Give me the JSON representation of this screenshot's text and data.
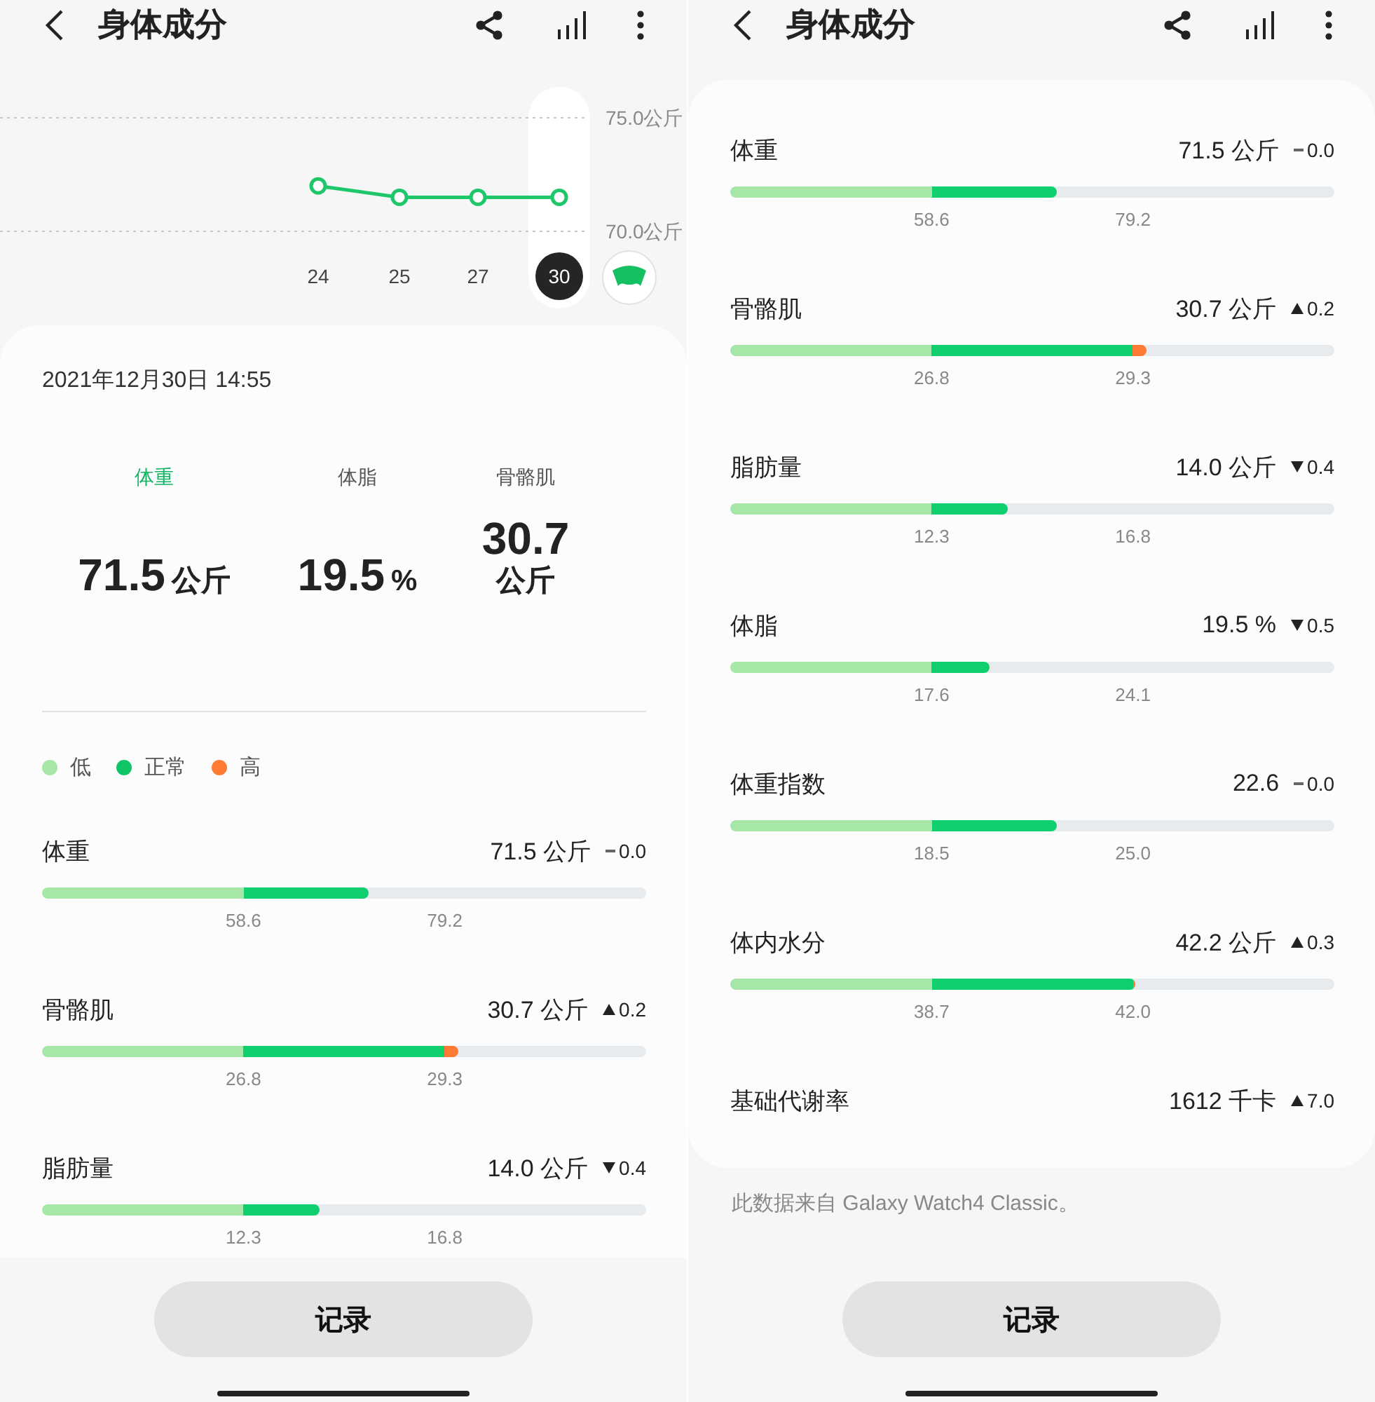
{
  "screens": [
    {
      "header": {
        "title": "身体成分"
      },
      "trend": {
        "chart_data": {
          "type": "line",
          "categories": [
            "24",
            "25",
            "27",
            "30"
          ],
          "series": [
            {
              "color": "#1ec86a",
              "marker": "circle",
              "values": [
                72.0,
                71.5,
                71.5,
                71.5
              ]
            }
          ],
          "ylim": [
            70,
            75
          ],
          "yticks": [
            {
              "value": 75,
              "label": "75.0公斤"
            },
            {
              "value": 70,
              "label": "70.0公斤"
            }
          ]
        },
        "points": [
          {
            "selected": false
          },
          {
            "selected": false
          },
          {
            "selected": false
          },
          {
            "selected": true
          }
        ]
      },
      "date": "2021年12月30日 14:55",
      "tabs": [
        {
          "label": "体重",
          "value": "71.5",
          "unit": "公斤",
          "selected": true
        },
        {
          "label": "体脂",
          "value": "19.5",
          "unit": "%",
          "selected": false
        },
        {
          "label": "骨骼肌",
          "value": "30.7",
          "unit": "公斤",
          "selected": false
        }
      ],
      "legend": [
        {
          "label": "低",
          "color": "#a6e6a6"
        },
        {
          "label": "正常",
          "color": "#10c566"
        },
        {
          "label": "高",
          "color": "#ff7a33"
        }
      ],
      "rows": [
        {
          "name": "体重",
          "value": "71.5 公斤",
          "kind": "same",
          "change": "0.0",
          "level": 0.54,
          "low": "58.6",
          "high": "79.2"
        },
        {
          "name": "骨骼肌",
          "value": "30.7 公斤",
          "kind": "up",
          "change": "0.2",
          "level": 0.69,
          "low": "26.8",
          "high": "29.3"
        },
        {
          "name": "脂肪量",
          "value": "14.0 公斤",
          "kind": "down",
          "change": "0.4",
          "level": 0.46,
          "low": "12.3",
          "high": "16.8"
        }
      ],
      "button": "记录"
    },
    {
      "header": {
        "title": "身体成分"
      },
      "rows": [
        {
          "name": "体重",
          "value": "71.5 公斤",
          "kind": "same",
          "change": "0.0",
          "level": 0.54,
          "low": "58.6",
          "high": "79.2"
        },
        {
          "name": "骨骼肌",
          "value": "30.7 公斤",
          "kind": "up",
          "change": "0.2",
          "level": 0.69,
          "low": "26.8",
          "high": "29.3"
        },
        {
          "name": "脂肪量",
          "value": "14.0 公斤",
          "kind": "down",
          "change": "0.4",
          "level": 0.46,
          "low": "12.3",
          "high": "16.8"
        },
        {
          "name": "体脂",
          "value": "19.5 %",
          "kind": "down",
          "change": "0.5",
          "level": 0.43,
          "low": "17.6",
          "high": "24.1"
        },
        {
          "name": "体重指数",
          "value": "22.6",
          "kind": "same",
          "change": "0.0",
          "level": 0.54,
          "low": "18.5",
          "high": "25.0"
        },
        {
          "name": "体内水分",
          "value": "42.2 公斤",
          "kind": "up",
          "change": "0.3",
          "level": 0.67,
          "low": "38.7",
          "high": "42.0"
        },
        {
          "name": "基础代谢率",
          "value": "1612 千卡",
          "kind": "up",
          "change": "7.0"
        }
      ],
      "source_note": "此数据来自 Galaxy Watch4 Classic。",
      "button": "记录"
    }
  ]
}
